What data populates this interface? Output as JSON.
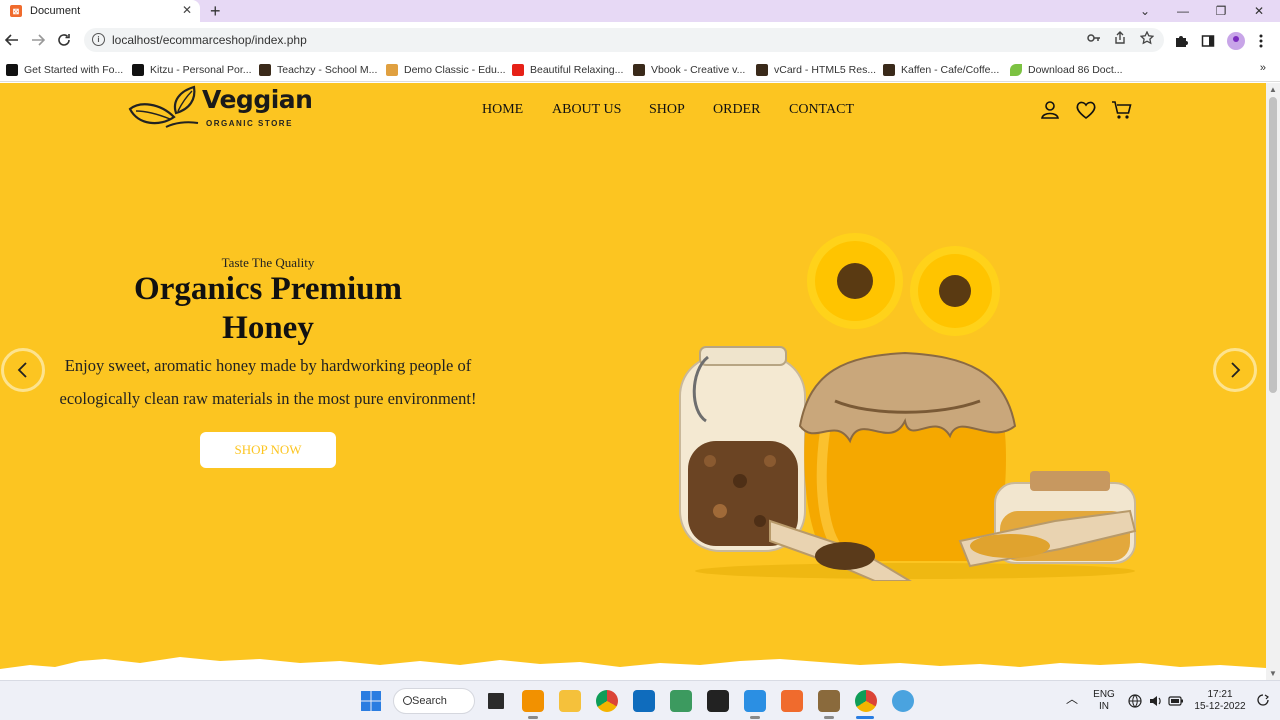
{
  "browser": {
    "tab_title": "Document",
    "tab_close": "✕",
    "new_tab": "+",
    "url": "localhost/ecommarceshop/index.php",
    "window_controls": [
      "⌄",
      "—",
      "❐",
      "✕"
    ]
  },
  "bookmarks": [
    {
      "label": "Get Started with Fo...",
      "color": "#111111"
    },
    {
      "label": "Kitzu - Personal Por...",
      "color": "#111111"
    },
    {
      "label": "Teachzy - School M...",
      "color": "#3a2a1a"
    },
    {
      "label": "Demo Classic - Edu...",
      "color": "#e0a040"
    },
    {
      "label": "Beautiful Relaxing...",
      "color": "#e62117"
    },
    {
      "label": "Vbook - Creative v...",
      "color": "#3a2a1a"
    },
    {
      "label": "vCard - HTML5 Res...",
      "color": "#3a2a1a"
    },
    {
      "label": "Kaffen - Cafe/Coffe...",
      "color": "#3a2a1a"
    },
    {
      "label": "Download 86 Doct...",
      "color": "#7cc242"
    }
  ],
  "bookmarks_more": "»",
  "site": {
    "logo_title": "Veggian",
    "logo_subtitle": "ORGANIC STORE",
    "nav": [
      "HOME",
      "ABOUT US",
      "SHOP",
      "ORDER",
      "CONTACT"
    ],
    "hero": {
      "tagline": "Taste The Quality",
      "headline": "Organics Premium Honey",
      "description": "Enjoy sweet, aromatic honey made by hardworking people of ecologically clean raw materials in the most pure environment!",
      "button": "SHOP NOW"
    },
    "colors": {
      "brand_yellow": "#fcc521",
      "text_dark": "#111111"
    }
  },
  "taskbar": {
    "search_label": "Search",
    "lang_line1": "ENG",
    "lang_line2": "IN",
    "time": "17:21",
    "date": "15-12-2022"
  }
}
